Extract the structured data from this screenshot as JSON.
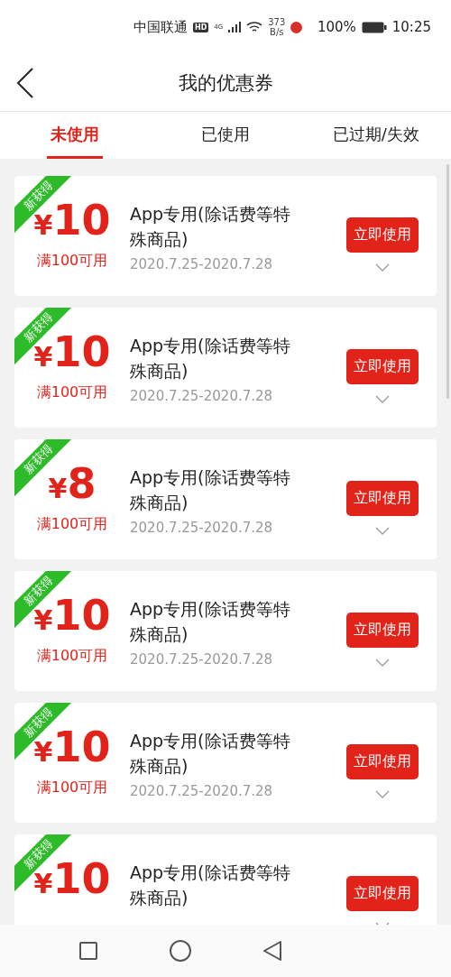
{
  "status_bar": {
    "carrier": "中国联通",
    "hd": "HD",
    "network": "4G",
    "speed_value": "373",
    "speed_unit": "B/s",
    "battery": "100%",
    "time": "10:25"
  },
  "header": {
    "title": "我的优惠券"
  },
  "tabs": [
    {
      "label": "未使用",
      "selected": true
    },
    {
      "label": "已使用",
      "selected": false
    },
    {
      "label": "已过期/失效",
      "selected": false
    }
  ],
  "coupons": [
    {
      "badge": "新获得",
      "currency": "¥",
      "amount": "10",
      "condition": "满100可用",
      "title": "App专用(除话费等特殊商品)",
      "dates": "2020.7.25-2020.7.28",
      "button": "立即使用"
    },
    {
      "badge": "新获得",
      "currency": "¥",
      "amount": "10",
      "condition": "满100可用",
      "title": "App专用(除话费等特殊商品)",
      "dates": "2020.7.25-2020.7.28",
      "button": "立即使用"
    },
    {
      "badge": "新获得",
      "currency": "¥",
      "amount": "8",
      "condition": "满100可用",
      "title": "App专用(除话费等特殊商品)",
      "dates": "2020.7.25-2020.7.28",
      "button": "立即使用"
    },
    {
      "badge": "新获得",
      "currency": "¥",
      "amount": "10",
      "condition": "满100可用",
      "title": "App专用(除话费等特殊商品)",
      "dates": "2020.7.25-2020.7.28",
      "button": "立即使用"
    },
    {
      "badge": "新获得",
      "currency": "¥",
      "amount": "10",
      "condition": "满100可用",
      "title": "App专用(除话费等特殊商品)",
      "dates": "2020.7.25-2020.7.28",
      "button": "立即使用"
    },
    {
      "badge": "新获得",
      "currency": "¥",
      "amount": "10",
      "title": "App专用(除话费等特殊商品)",
      "button": "立即使用"
    }
  ]
}
